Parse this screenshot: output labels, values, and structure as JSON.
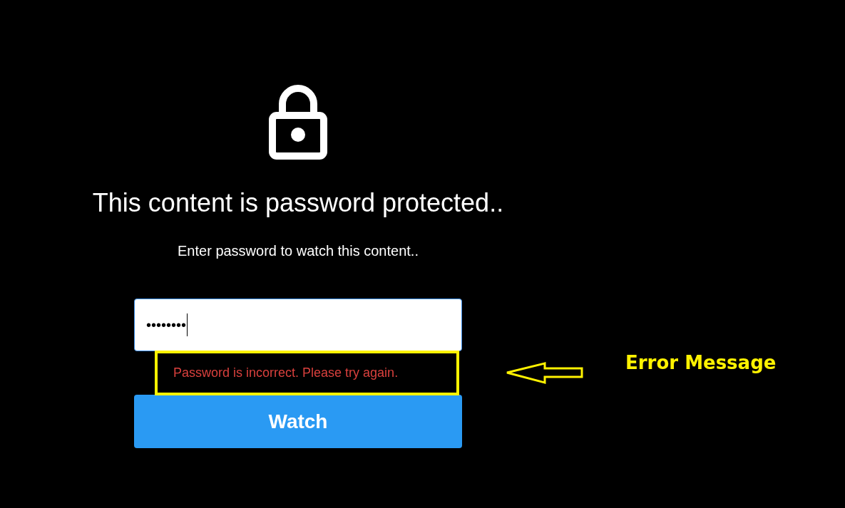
{
  "title": "This content is password protected..",
  "subtitle": "Enter password to watch this content..",
  "password_field": {
    "value": "••••••••",
    "focused": true
  },
  "error_message": "Password is incorrect. Please try again.",
  "button": "Watch",
  "annotation": {
    "label": "Error Message"
  }
}
